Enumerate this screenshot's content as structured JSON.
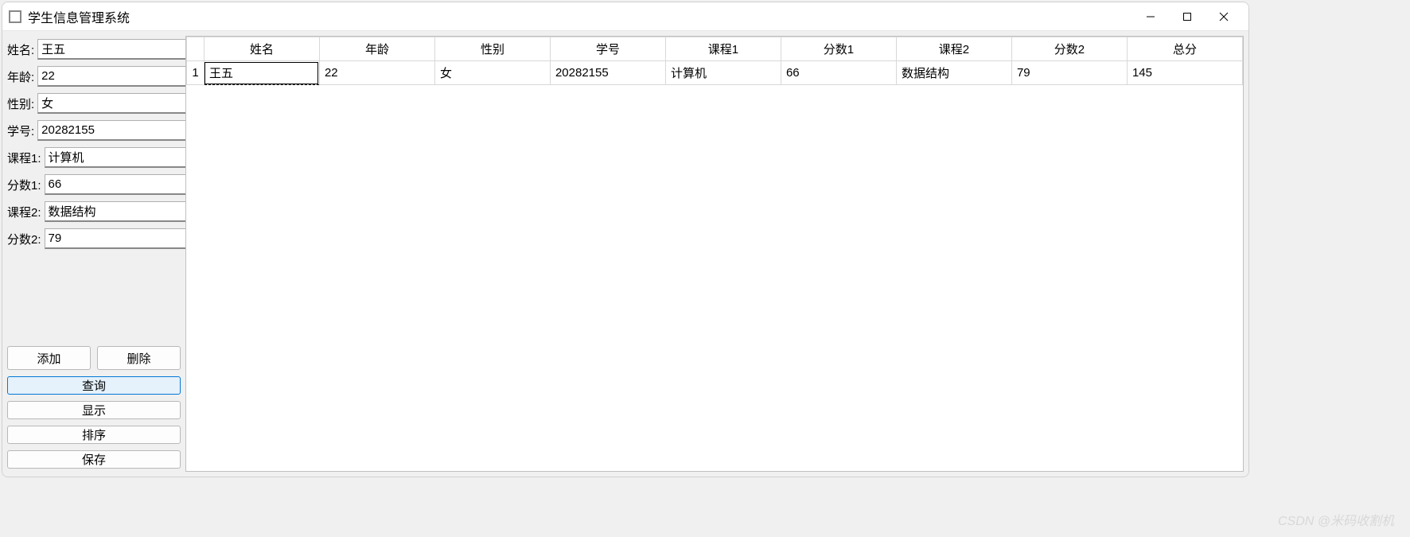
{
  "window": {
    "title": "学生信息管理系统"
  },
  "form": {
    "fields": [
      {
        "label": "姓名:",
        "value": "王五",
        "name": "name"
      },
      {
        "label": "年龄:",
        "value": "22",
        "name": "age"
      },
      {
        "label": "性别:",
        "value": "女",
        "name": "gender"
      },
      {
        "label": "学号:",
        "value": "20282155",
        "name": "student-id"
      },
      {
        "label": "课程1:",
        "value": "计算机",
        "name": "course1"
      },
      {
        "label": "分数1:",
        "value": "66",
        "name": "score1"
      },
      {
        "label": "课程2:",
        "value": "数据结构",
        "name": "course2"
      },
      {
        "label": "分数2:",
        "value": "79",
        "name": "score2"
      }
    ]
  },
  "buttons": {
    "add": "添加",
    "delete": "删除",
    "query": "查询",
    "display": "显示",
    "sort": "排序",
    "save": "保存"
  },
  "table": {
    "headers": [
      "姓名",
      "年龄",
      "性别",
      "学号",
      "课程1",
      "分数1",
      "课程2",
      "分数2",
      "总分"
    ],
    "rows": [
      {
        "index": "1",
        "cells": [
          "王五",
          "22",
          "女",
          "20282155",
          "计算机",
          "66",
          "数据结构",
          "79",
          "145"
        ]
      }
    ]
  },
  "watermark": "CSDN @米码收割机"
}
